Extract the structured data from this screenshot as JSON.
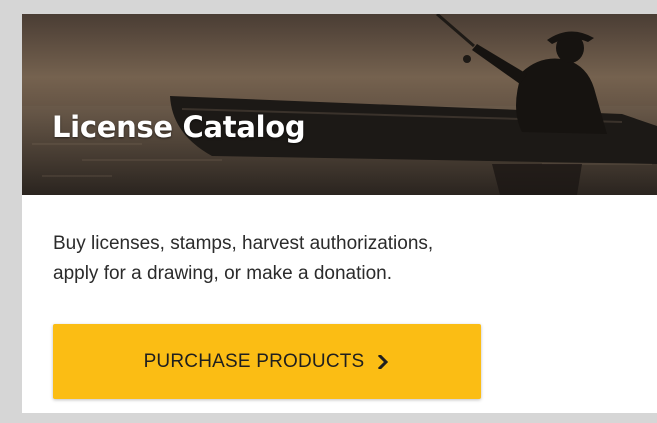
{
  "card": {
    "title": "License Catalog",
    "description_line1": "Buy licenses, stamps, harvest authorizations,",
    "description_line2": "apply for a drawing, or make a donation.",
    "button_label": "PURCHASE PRODUCTS",
    "button_icon": "chevron-right-icon",
    "hero_image": "fisherman-in-boat-silhouette"
  },
  "colors": {
    "button_background": "#fbbd14",
    "page_background": "#d6d6d6",
    "card_background": "#ffffff",
    "title_text": "#ffffff"
  }
}
